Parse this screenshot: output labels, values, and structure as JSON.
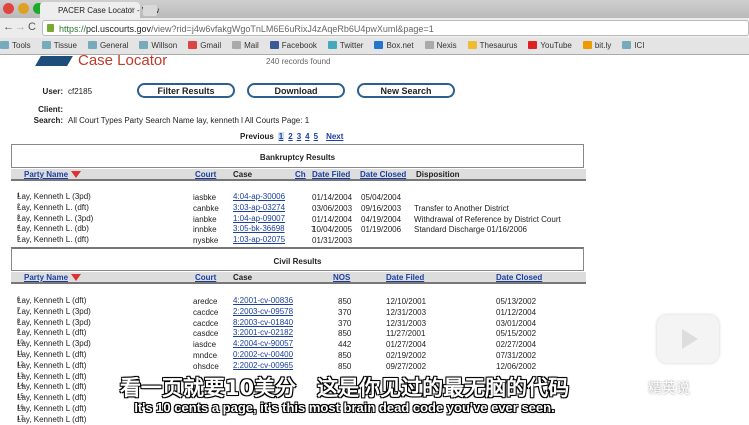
{
  "browser": {
    "tab_title": "PACER Case Locator - View",
    "url_scheme": "https://",
    "url_domain": "pcl.uscourts.gov",
    "url_path": "/view?rid=j4w6vfakgWgoTnLM6E6uRixJ4zAqeRb6U4pwXuml&page=1",
    "bookmarks": [
      {
        "label": "Tools",
        "color": "#7ab"
      },
      {
        "label": "Tissue",
        "color": "#7ab"
      },
      {
        "label": "General",
        "color": "#7ab"
      },
      {
        "label": "Willson",
        "color": "#7ab"
      },
      {
        "label": "Gmail",
        "color": "#d44"
      },
      {
        "label": "Mail",
        "color": "#aaa"
      },
      {
        "label": "Facebook",
        "color": "#3b5998"
      },
      {
        "label": "Twitter",
        "color": "#4ab"
      },
      {
        "label": "Box.net",
        "color": "#27c"
      },
      {
        "label": "Nexis",
        "color": "#aaa"
      },
      {
        "label": "Thesaurus",
        "color": "#eb3"
      },
      {
        "label": "YouTube",
        "color": "#d22"
      },
      {
        "label": "bit.ly",
        "color": "#e90"
      },
      {
        "label": "ICI",
        "color": "#7ab"
      }
    ]
  },
  "header": {
    "logo": "Case Locator",
    "records": "240 records found",
    "user_label": "User:",
    "user": "cf2185",
    "client_label": "Client:",
    "search_label": "Search:",
    "search": "All Court Types Party Search Name lay, kenneth l All Courts Page: 1"
  },
  "buttons": {
    "filter": "Filter Results",
    "download": "Download",
    "new_search": "New Search"
  },
  "pager": {
    "previous": "Previous",
    "pages": [
      "1",
      "2",
      "3",
      "4",
      "5"
    ],
    "next": "Next"
  },
  "bankruptcy": {
    "title": "Bankruptcy Results",
    "columns": [
      "Party Name",
      "Court",
      "Case",
      "Ch",
      "Date Filed",
      "Date Closed",
      "Disposition"
    ],
    "rows": [
      {
        "n": "1",
        "party": "Lay, Kenneth L (3pd)",
        "court": "iasbke",
        "case": "4:04-ap-30006",
        "ch": "",
        "filed": "01/14/2004",
        "closed": "05/04/2004",
        "disp": ""
      },
      {
        "n": "2",
        "party": "Lay, Kenneth L. (dft)",
        "court": "canbke",
        "case": "3:03-ap-03274",
        "ch": "",
        "filed": "03/06/2003",
        "closed": "09/16/2003",
        "disp": "Transfer to Another District"
      },
      {
        "n": "3",
        "party": "Lay, Kenneth L. (3pd)",
        "court": "ianbke",
        "case": "1:04-ap-09007",
        "ch": "",
        "filed": "01/14/2004",
        "closed": "04/19/2004",
        "disp": "Withdrawal of Reference by District Court"
      },
      {
        "n": "4",
        "party": "Lay, Kenneth L. (db)",
        "court": "innbke",
        "case": "3:05-bk-36698",
        "ch": "7",
        "filed": "10/04/2005",
        "closed": "01/19/2006",
        "disp": "Standard Discharge 01/16/2006"
      },
      {
        "n": "5",
        "party": "Lay, Kenneth L. (dft)",
        "court": "nysbke",
        "case": "1:03-ap-02075",
        "ch": "",
        "filed": "01/31/2003",
        "closed": "",
        "disp": ""
      }
    ]
  },
  "civil": {
    "title": "Civil Results",
    "columns": [
      "Party Name",
      "Court",
      "Case",
      "NOS",
      "Date Filed",
      "Date Closed"
    ],
    "rows": [
      {
        "n": "6",
        "party": "Lay, Kenneth L (dft)",
        "court": "aredce",
        "case": "4:2001-cv-00836",
        "nos": "850",
        "filed": "12/10/2001",
        "closed": "05/13/2002"
      },
      {
        "n": "7",
        "party": "Lay, Kenneth L (3pd)",
        "court": "cacdce",
        "case": "2:2003-cv-09578",
        "nos": "370",
        "filed": "12/31/2003",
        "closed": "01/12/2004"
      },
      {
        "n": "8",
        "party": "Lay, Kenneth L (3pd)",
        "court": "cacdce",
        "case": "8:2003-cv-01840",
        "nos": "370",
        "filed": "12/31/2003",
        "closed": "03/01/2004"
      },
      {
        "n": "9",
        "party": "Lay, Kenneth L (dft)",
        "court": "casdce",
        "case": "3:2001-cv-02182",
        "nos": "850",
        "filed": "11/27/2001",
        "closed": "05/15/2002"
      },
      {
        "n": "10",
        "party": "Lay, Kenneth L (3pd)",
        "court": "iasdce",
        "case": "4:2004-cv-90057",
        "nos": "442",
        "filed": "01/27/2004",
        "closed": "02/27/2004"
      },
      {
        "n": "11",
        "party": "Lay, Kenneth L (dft)",
        "court": "mndce",
        "case": "0:2002-cv-00400",
        "nos": "850",
        "filed": "02/19/2002",
        "closed": "07/31/2002"
      },
      {
        "n": "12",
        "party": "Lay, Kenneth L (dft)",
        "court": "ohsdce",
        "case": "2:2002-cv-00965",
        "nos": "850",
        "filed": "09/27/2002",
        "closed": "12/06/2002"
      },
      {
        "n": "13",
        "party": "Lay, Kenneth L (dft)",
        "court": "",
        "case": "",
        "nos": "",
        "filed": "",
        "closed": ""
      },
      {
        "n": "14",
        "party": "Lay, Kenneth L (dft)",
        "court": "",
        "case": "",
        "nos": "",
        "filed": "",
        "closed": ""
      },
      {
        "n": "15",
        "party": "Lay, Kenneth L (dft)",
        "court": "",
        "case": "",
        "nos": "",
        "filed": "",
        "closed": ""
      },
      {
        "n": "16",
        "party": "Lay, Kenneth L (dft)",
        "court": "",
        "case": "",
        "nos": "",
        "filed": "",
        "closed": ""
      },
      {
        "n": "17",
        "party": "Lay, Kenneth L (dft)",
        "court": "",
        "case": "",
        "nos": "",
        "filed": "",
        "closed": ""
      }
    ]
  },
  "subtitles": {
    "zh": "看一页就要10美分　这是你见过的最无脑的代码",
    "en": "It's 10 cents a page, it's this most brain dead code you've ever seen."
  },
  "watermark": "精英说"
}
